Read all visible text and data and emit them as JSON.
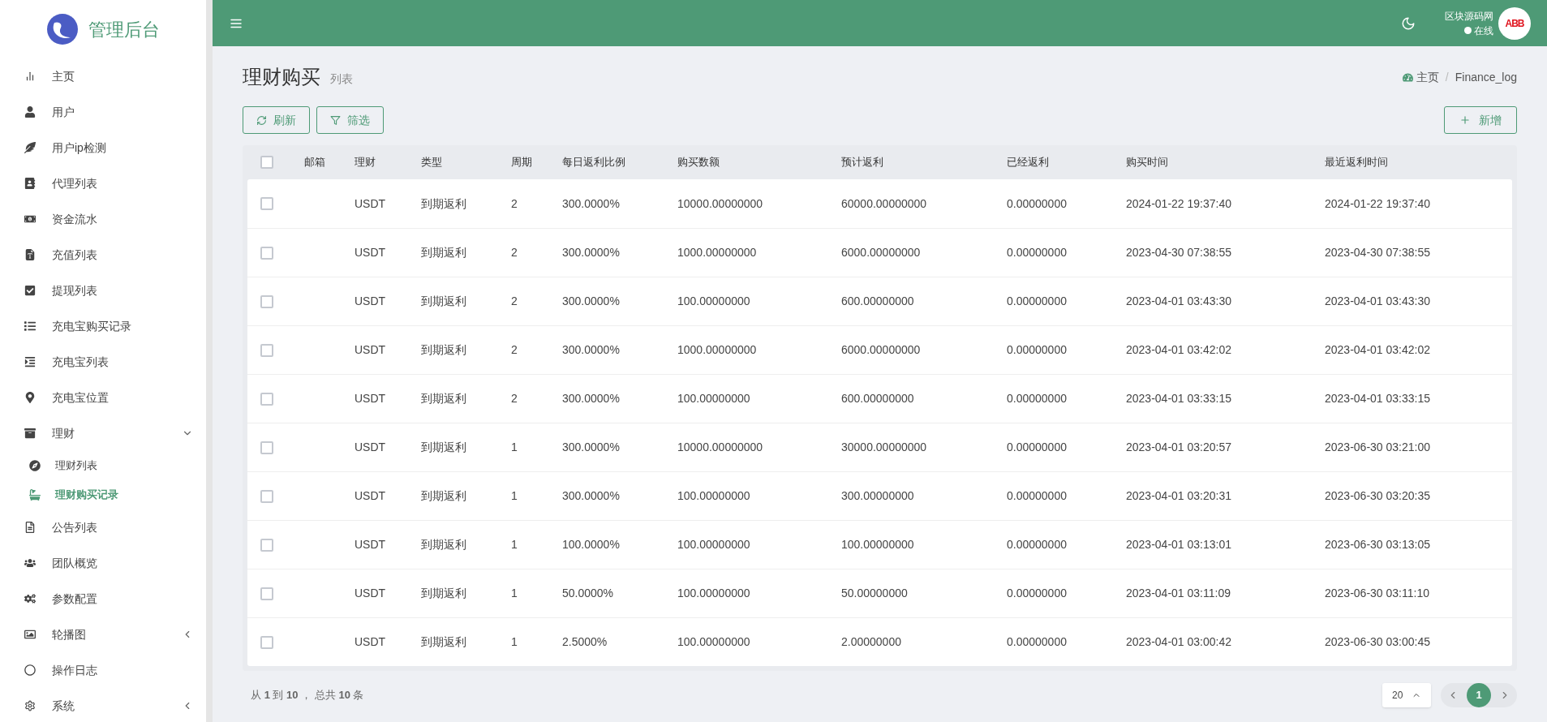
{
  "brand": {
    "title": "管理后台"
  },
  "sidebar": {
    "items": [
      {
        "label": "主页",
        "kind": "item",
        "selected": false
      },
      {
        "label": "用户",
        "kind": "item",
        "selected": false
      },
      {
        "label": "用户ip检测",
        "kind": "item",
        "selected": false
      },
      {
        "label": "代理列表",
        "kind": "item",
        "selected": false
      },
      {
        "label": "资金流水",
        "kind": "item",
        "selected": false
      },
      {
        "label": "充值列表",
        "kind": "item",
        "selected": false
      },
      {
        "label": "提现列表",
        "kind": "item",
        "selected": false
      },
      {
        "label": "充电宝购买记录",
        "kind": "item",
        "selected": false
      },
      {
        "label": "充电宝列表",
        "kind": "item",
        "selected": false
      },
      {
        "label": "充电宝位置",
        "kind": "item",
        "selected": false
      },
      {
        "label": "理财",
        "kind": "group",
        "expanded": true,
        "selected": false,
        "children": [
          {
            "label": "理财列表",
            "selected": false
          },
          {
            "label": "理财购买记录",
            "selected": true
          }
        ]
      },
      {
        "label": "公告列表",
        "kind": "item",
        "selected": false
      },
      {
        "label": "团队概览",
        "kind": "item",
        "selected": false
      },
      {
        "label": "参数配置",
        "kind": "item",
        "selected": false
      },
      {
        "label": "轮播图",
        "kind": "group",
        "expanded": false,
        "selected": false
      },
      {
        "label": "操作日志",
        "kind": "item",
        "selected": false
      },
      {
        "label": "系统",
        "kind": "group",
        "expanded": false,
        "selected": false
      }
    ]
  },
  "user": {
    "name": "区块源码网",
    "status": "在线",
    "avatar_text": "ABB"
  },
  "page": {
    "title": "理财购买",
    "subtitle": "列表"
  },
  "breadcrumb": {
    "separator": "/",
    "items": [
      {
        "label": "主页"
      },
      {
        "label": "Finance_log"
      }
    ]
  },
  "toolbar": {
    "left": [
      "刷新",
      "筛选"
    ],
    "right": "新增"
  },
  "table": {
    "all_checked": false,
    "columns": [
      "邮箱",
      "理财",
      "类型",
      "周期",
      "每日返利比例",
      "购买数额",
      "预计返利",
      "已经返利",
      "购买时间",
      "最近返利时间"
    ],
    "rows": [
      {
        "checked": false,
        "cells": [
          "",
          "USDT",
          "到期返利",
          "2",
          "300.0000%",
          "10000.00000000",
          "60000.00000000",
          "0.00000000",
          "2024-01-22 19:37:40",
          "2024-01-22 19:37:40"
        ]
      },
      {
        "checked": false,
        "cells": [
          "",
          "USDT",
          "到期返利",
          "2",
          "300.0000%",
          "1000.00000000",
          "6000.00000000",
          "0.00000000",
          "2023-04-30 07:38:55",
          "2023-04-30 07:38:55"
        ]
      },
      {
        "checked": false,
        "cells": [
          "",
          "USDT",
          "到期返利",
          "2",
          "300.0000%",
          "100.00000000",
          "600.00000000",
          "0.00000000",
          "2023-04-01 03:43:30",
          "2023-04-01 03:43:30"
        ]
      },
      {
        "checked": false,
        "cells": [
          "",
          "USDT",
          "到期返利",
          "2",
          "300.0000%",
          "1000.00000000",
          "6000.00000000",
          "0.00000000",
          "2023-04-01 03:42:02",
          "2023-04-01 03:42:02"
        ]
      },
      {
        "checked": false,
        "cells": [
          "",
          "USDT",
          "到期返利",
          "2",
          "300.0000%",
          "100.00000000",
          "600.00000000",
          "0.00000000",
          "2023-04-01 03:33:15",
          "2023-04-01 03:33:15"
        ]
      },
      {
        "checked": false,
        "cells": [
          "",
          "USDT",
          "到期返利",
          "1",
          "300.0000%",
          "10000.00000000",
          "30000.00000000",
          "0.00000000",
          "2023-04-01 03:20:57",
          "2023-06-30 03:21:00"
        ]
      },
      {
        "checked": false,
        "cells": [
          "",
          "USDT",
          "到期返利",
          "1",
          "300.0000%",
          "100.00000000",
          "300.00000000",
          "0.00000000",
          "2023-04-01 03:20:31",
          "2023-06-30 03:20:35"
        ]
      },
      {
        "checked": false,
        "cells": [
          "",
          "USDT",
          "到期返利",
          "1",
          "100.0000%",
          "100.00000000",
          "100.00000000",
          "0.00000000",
          "2023-04-01 03:13:01",
          "2023-06-30 03:13:05"
        ]
      },
      {
        "checked": false,
        "cells": [
          "",
          "USDT",
          "到期返利",
          "1",
          "50.0000%",
          "100.00000000",
          "50.00000000",
          "0.00000000",
          "2023-04-01 03:11:09",
          "2023-06-30 03:11:10"
        ]
      },
      {
        "checked": false,
        "cells": [
          "",
          "USDT",
          "到期返利",
          "1",
          "2.5000%",
          "100.00000000",
          "2.00000000",
          "0.00000000",
          "2023-04-01 03:00:42",
          "2023-06-30 03:00:45"
        ]
      }
    ]
  },
  "footer": {
    "summary": "从 **1** 到 **10** ， 总共 **10** 条",
    "page_size": "20",
    "pages": [
      {
        "label": "1",
        "selected": true
      }
    ]
  }
}
